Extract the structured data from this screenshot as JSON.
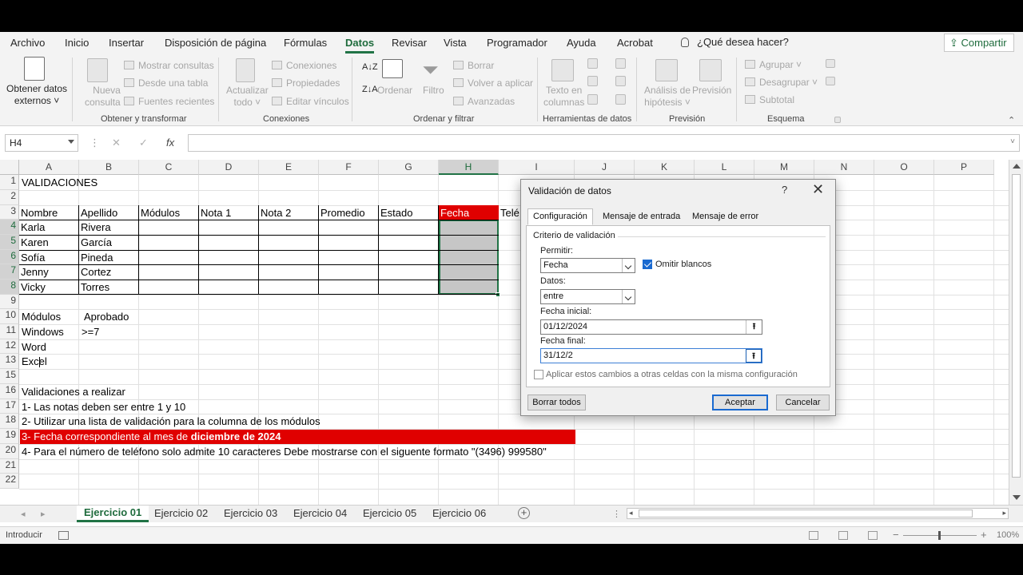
{
  "ribbon": {
    "tabs": [
      "Archivo",
      "Inicio",
      "Insertar",
      "Disposición de página",
      "Fórmulas",
      "Datos",
      "Revisar",
      "Vista",
      "Programador",
      "Ayuda",
      "Acrobat"
    ],
    "active_tab": "Datos",
    "tell_me": "¿Qué desea hacer?",
    "share": "Compartir",
    "obtener_datos": [
      "Obtener datos",
      "externos ˅"
    ],
    "nueva_consulta": [
      "Nueva",
      "consulta ˅"
    ],
    "mostrar_consultas": "Mostrar consultas",
    "desde_tabla": "Desde una tabla",
    "fuentes_recientes": "Fuentes recientes",
    "actualizar": [
      "Actualizar",
      "todo ˅"
    ],
    "conexiones": "Conexiones",
    "propiedades": "Propiedades",
    "editar_vinculos": "Editar vínculos",
    "ordenar": "Ordenar",
    "filtro": "Filtro",
    "borrar": "Borrar",
    "volver_aplicar": "Volver a aplicar",
    "avanzadas": "Avanzadas",
    "texto_columnas": [
      "Texto en",
      "columnas"
    ],
    "analisis": [
      "Análisis de",
      "hipótesis ˅"
    ],
    "prevision": "Previsión",
    "agrupar": "Agrupar",
    "desagrupar": "Desagrupar",
    "subtotal": "Subtotal",
    "groups": {
      "g1": "Obtener y transformar",
      "g2": "Conexiones",
      "g3": "Ordenar y filtrar",
      "g4": "Herramientas de datos",
      "g5": "Previsión",
      "g6": "Esquema"
    }
  },
  "formula_bar": {
    "name_box": "H4",
    "cancel": "✕",
    "enter": "✓",
    "fx": "fx",
    "value": ""
  },
  "grid": {
    "columns": [
      "A",
      "B",
      "C",
      "D",
      "E",
      "F",
      "G",
      "H",
      "I",
      "J",
      "K",
      "L",
      "M",
      "N",
      "O",
      "P"
    ],
    "selected_column": "H",
    "rows": [
      "1",
      "2",
      "3",
      "4",
      "5",
      "6",
      "7",
      "8",
      "9",
      "10",
      "11",
      "12",
      "13",
      "15",
      "16",
      "17",
      "18",
      "19",
      "20",
      "21",
      "22"
    ],
    "cells": {
      "a1": "VALIDACIONES",
      "headers": [
        "Nombre",
        "Apellido",
        "Módulos",
        "Nota 1",
        "Nota 2",
        "Promedio",
        "Estado",
        "Fecha",
        "Telé"
      ],
      "students": [
        [
          "Karla",
          "Rivera"
        ],
        [
          "Karen",
          "García"
        ],
        [
          "Sofía",
          "Pineda"
        ],
        [
          "Jenny",
          "Cortez"
        ],
        [
          "Vicky",
          "Torres"
        ]
      ],
      "modulos": "Módulos",
      "aprobado": "Aprobado",
      "windows": "Windows",
      "ge7": ">=7",
      "word": "Word",
      "excel": "Excel",
      "validaciones": "Validaciones a realizar",
      "v1": "1- Las notas deben ser entre 1 y 10",
      "v2": "2- Utilizar una lista de validación para la columna de los módulos",
      "v3a": "3- Fecha correspondiente al mes de ",
      "v3b": "diciembre de 2024",
      "v4": "4- Para el número de teléfono solo admite 10 caracteres Debe mostrarse con el siguente formato \"(3496) 999580\""
    }
  },
  "sheets": {
    "tabs": [
      "Ejercicio 01",
      "Ejercicio 02",
      "Ejercicio 03",
      "Ejercicio 04",
      "Ejercicio 05",
      "Ejercicio 06"
    ],
    "active": "Ejercicio 01"
  },
  "status": {
    "mode": "Introducir",
    "zoom": "100%"
  },
  "dialog": {
    "title": "Validación de datos",
    "help": "?",
    "close": "✕",
    "tabs": [
      "Configuración",
      "Mensaje de entrada",
      "Mensaje de error"
    ],
    "active_tab": "Configuración",
    "section": "Criterio de validación",
    "permitir_label": "Permitir:",
    "permitir_value": "Fecha",
    "omitir_blancos": "Omitir blancos",
    "omitir_checked": true,
    "datos_label": "Datos:",
    "datos_value": "entre",
    "fecha_inicial_label": "Fecha inicial:",
    "fecha_inicial_value": "01/12/2024",
    "fecha_final_label": "Fecha final:",
    "fecha_final_value": "31/12/2",
    "ref_glyph": "⭱",
    "aplicar": "Aplicar estos cambios a otras celdas con la misma configuración",
    "borrar_todos": "Borrar todos",
    "aceptar": "Aceptar",
    "cancelar": "Cancelar"
  },
  "colors": {
    "accent": "#217346",
    "highlight_red": "#e00000",
    "dialog_default": "#1a6ad0"
  }
}
